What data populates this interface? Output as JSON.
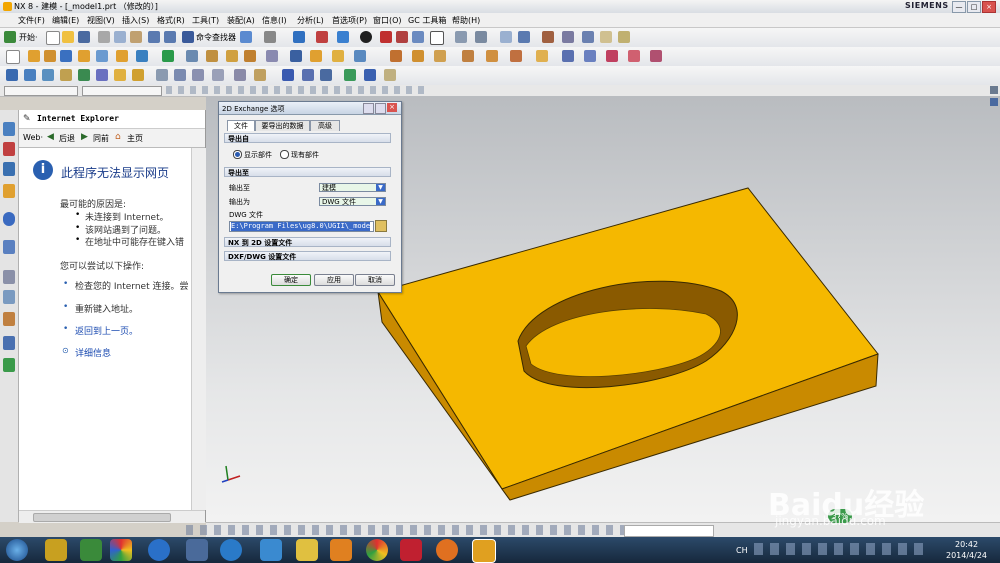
{
  "window": {
    "title": "NX 8 - 建模 - [_model1.prt （修改的）]",
    "brand": "SIEMENS",
    "min_glyph": "—",
    "max_glyph": "□",
    "close_glyph": "×"
  },
  "menu": {
    "items": [
      "文件(F)",
      "编辑(E)",
      "视图(V)",
      "插入(S)",
      "格式(R)",
      "工具(T)",
      "装配(A)",
      "信息(I)",
      "分析(L)",
      "首选项(P)",
      "窗口(O)",
      "GC 工具箱",
      "帮助(H)"
    ]
  },
  "toolbar": {
    "start_label": "开始·",
    "command_finder_label": "命令查找器"
  },
  "ie_panel": {
    "title": "Internet Explorer",
    "web_label": "Web·",
    "back_label": "后退",
    "forward_label": "同前",
    "home_label": "主页",
    "heading": "此程序无法显示网页",
    "possible_reasons": "最可能的原因是:",
    "reasons": [
      "未连接到 Internet。",
      "该网站遇到了问题。",
      "在地址中可能存在键入错"
    ],
    "try_label": "您可以尝试以下操作:",
    "actions": [
      "检查您的 Internet 连接。尝",
      "重新键入地址。",
      "返回到上一页。"
    ],
    "more_info": "详细信息"
  },
  "dialog": {
    "title": "2D Exchange 选项",
    "tabs": [
      "文件",
      "要导出的数据",
      "高级"
    ],
    "export_from_label": "导出自",
    "radio_displayed": "显示部件",
    "radio_existing": "现有部件",
    "export_to_label": "导出至",
    "output_to_label": "输出至",
    "output_to_value": "建模",
    "output_as_label": "输出为",
    "output_as_value": "DWG 文件",
    "dwg_file_label": "DWG 文件",
    "dwg_path": "E:\\Program Files\\ug8.0\\UGII\\_mode",
    "nx_to_2d_label": "NX 到 2D 设置文件",
    "dxf_dwg_label": "DXF/DWG 设置文件",
    "ok_label": "确定",
    "apply_label": "应用",
    "cancel_label": "取消"
  },
  "taskbar": {
    "time": "20:42",
    "date": "2014/4/24",
    "percent": "37%",
    "lang": "CH"
  },
  "watermark": {
    "brand": "Baidu经验",
    "url": "jingyan.baidu.com"
  },
  "colors": {
    "part_top": "#f5b800",
    "part_side": "#c98a00",
    "accent": "#3a6ac8"
  }
}
